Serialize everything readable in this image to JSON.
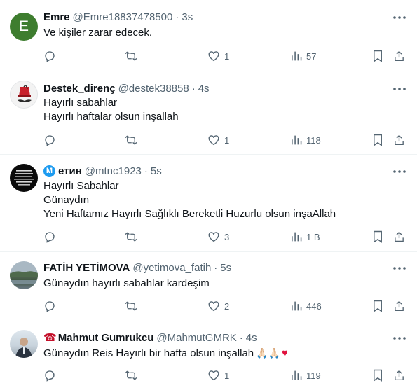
{
  "colors": {
    "text": "#0f1419",
    "muted": "#536471",
    "divider": "#eff3f4",
    "verified": "#1d9bf0"
  },
  "icons": [
    "more-icon",
    "reply-icon",
    "retweet-icon",
    "like-icon",
    "views-icon",
    "bookmark-icon",
    "share-icon"
  ],
  "tweets": [
    {
      "avatar_letter": "E",
      "name": "Emre",
      "handle": "@Emre18837478500",
      "sep": "·",
      "time": "3s",
      "lines": [
        "Ve kişiler zarar edecek."
      ],
      "likes": "1",
      "views": "57"
    },
    {
      "name": "Destek_direnç",
      "handle": "@destek38858",
      "sep": "·",
      "time": "4s",
      "lines": [
        "Hayırlı sabahlar",
        "Hayırlı haftalar olsun inşallah"
      ],
      "likes": "1",
      "views": "118"
    },
    {
      "name_badge": "M",
      "name": "етин",
      "handle": "@mtnc1923",
      "sep": "·",
      "time": "5s",
      "lines": [
        "Hayırlı Sabahlar",
        "Günaydın",
        "Yeni Haftamız Hayırlı Sağlıklı Bereketli Huzurlu olsun inşaAllah"
      ],
      "likes": "3",
      "views": "1 B"
    },
    {
      "name": "FATİH YETİMOVA",
      "handle": "@yetimova_fatih",
      "sep": "·",
      "time": "5s",
      "lines": [
        "Günaydın hayırlı sabahlar kardeşim"
      ],
      "likes": "2",
      "views": "446"
    },
    {
      "name_prefix": "☎",
      "name": "Mahmut Gumrukcu",
      "handle": "@MahmutGMRK",
      "sep": "·",
      "time": "4s",
      "lines": [
        "Günaydın Reis Hayırlı bir hafta olsun inşallah"
      ],
      "emoji": "🙏🏻🙏🏻",
      "heart": "♥",
      "likes": "1",
      "views": "119"
    }
  ]
}
